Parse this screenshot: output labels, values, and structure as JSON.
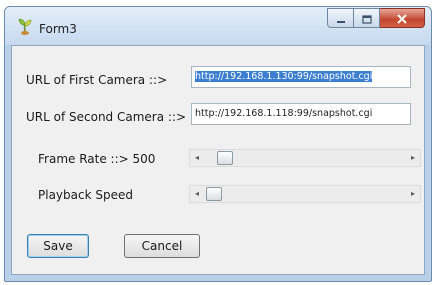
{
  "window": {
    "title": "Form3",
    "icon": "form-app-icon",
    "caption_buttons": [
      "minimize-icon",
      "maximize-icon",
      "close-icon"
    ]
  },
  "fields": {
    "first_camera": {
      "label": "URL of First Camera ::>",
      "value": "http://192.168.1.130:99/snapshot.cgi",
      "selected": true
    },
    "second_camera": {
      "label": "URL of Second Camera ::>",
      "value": "http://192.168.1.118:99/snapshot.cgi"
    }
  },
  "sliders": {
    "frame_rate": {
      "label": "Frame Rate ::> 500",
      "position": 0.06
    },
    "playback_speed": {
      "label": "Playback Speed",
      "position": 0.0
    }
  },
  "buttons": {
    "save": "Save",
    "cancel": "Cancel"
  },
  "colors": {
    "selection": "#3c7fd1",
    "close_button": "#c2472e",
    "titlebar": "#c5d9ef"
  }
}
